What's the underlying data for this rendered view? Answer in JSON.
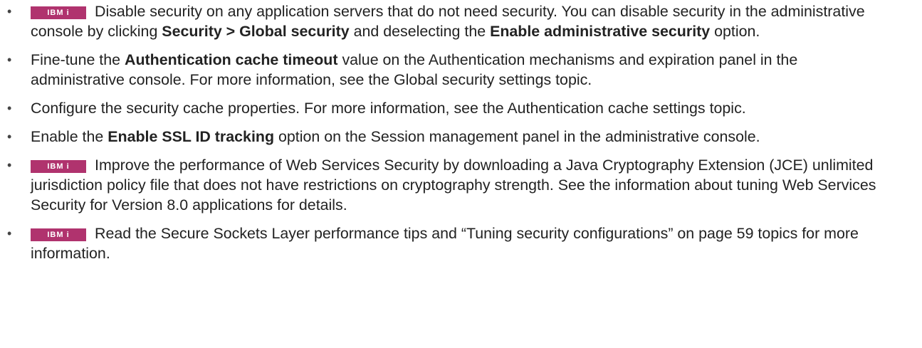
{
  "badge_label": "IBM i",
  "items": [
    {
      "badge": true,
      "parts": [
        {
          "t": "Disable security on any application servers that do not need security. You can disable security in the administrative console by clicking "
        },
        {
          "t": "Security > Global security",
          "b": true
        },
        {
          "t": " and deselecting the "
        },
        {
          "t": "Enable administrative security",
          "b": true
        },
        {
          "t": " option."
        }
      ]
    },
    {
      "badge": false,
      "parts": [
        {
          "t": "Fine-tune the "
        },
        {
          "t": "Authentication cache timeout",
          "b": true
        },
        {
          "t": " value on the Authentication mechanisms and expiration panel in the administrative console. For more information, see the Global security settings topic."
        }
      ]
    },
    {
      "badge": false,
      "parts": [
        {
          "t": "Configure the security cache properties. For more information, see the Authentication cache settings topic."
        }
      ]
    },
    {
      "badge": false,
      "parts": [
        {
          "t": "Enable the "
        },
        {
          "t": "Enable SSL ID tracking",
          "b": true
        },
        {
          "t": " option on the Session management panel in the administrative console."
        }
      ]
    },
    {
      "badge": true,
      "parts": [
        {
          "t": "Improve the performance of Web Services Security by downloading a Java Cryptography Extension (JCE) unlimited jurisdiction policy file that does not have restrictions on cryptography strength. See the information about tuning Web Services Security for Version 8.0 applications for details."
        }
      ]
    },
    {
      "badge": true,
      "parts": [
        {
          "t": "Read the Secure Sockets Layer performance tips and “Tuning security configurations” on page 59 topics for more information."
        }
      ]
    }
  ]
}
